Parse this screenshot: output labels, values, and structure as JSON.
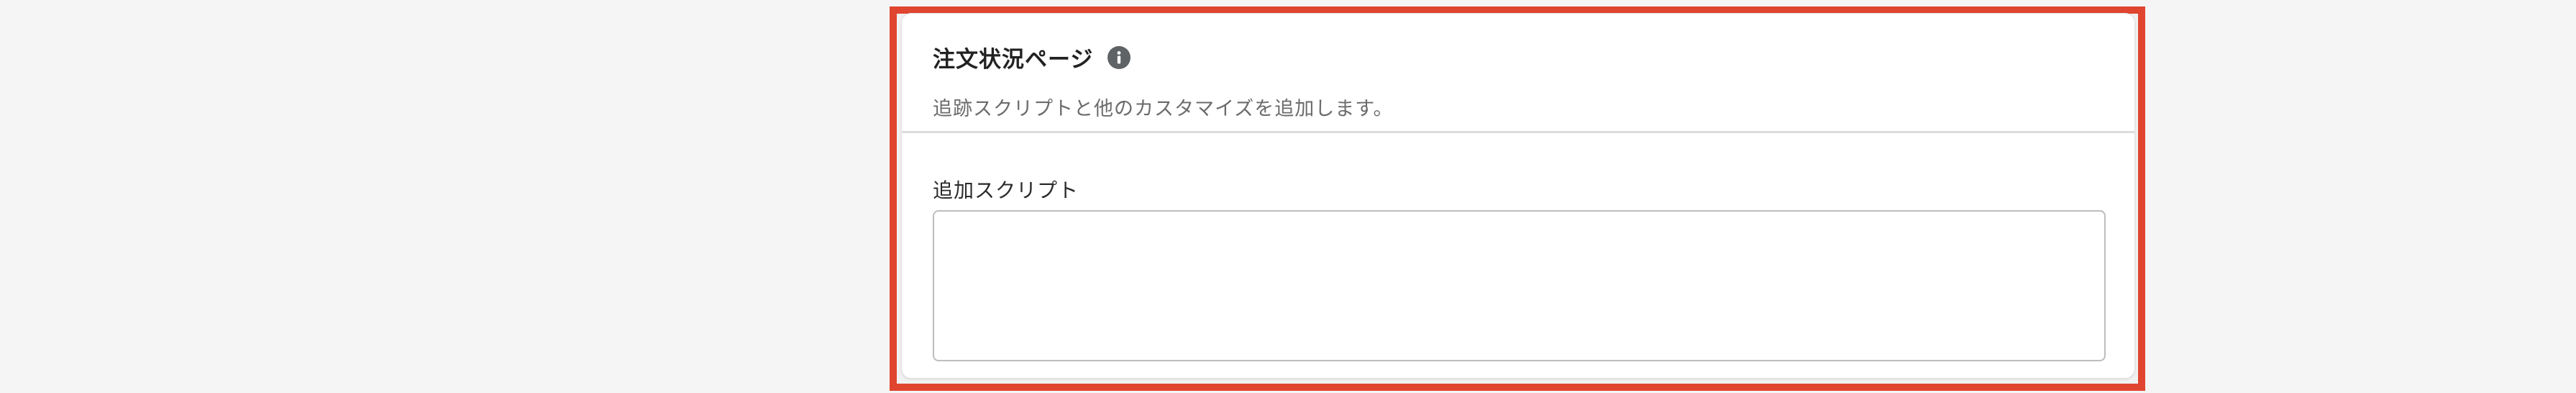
{
  "card": {
    "title": "注文状況ページ",
    "subtitle": "追跡スクリプトと他のカスタマイズを追加します。",
    "info_icon": "info-icon"
  },
  "additional_scripts": {
    "label": "追加スクリプト",
    "value": "",
    "placeholder": ""
  },
  "colors": {
    "highlight_border": "#e0452f",
    "page_background": "#f5f5f5",
    "card_background": "#ffffff",
    "info_icon_background": "#5f6366"
  }
}
